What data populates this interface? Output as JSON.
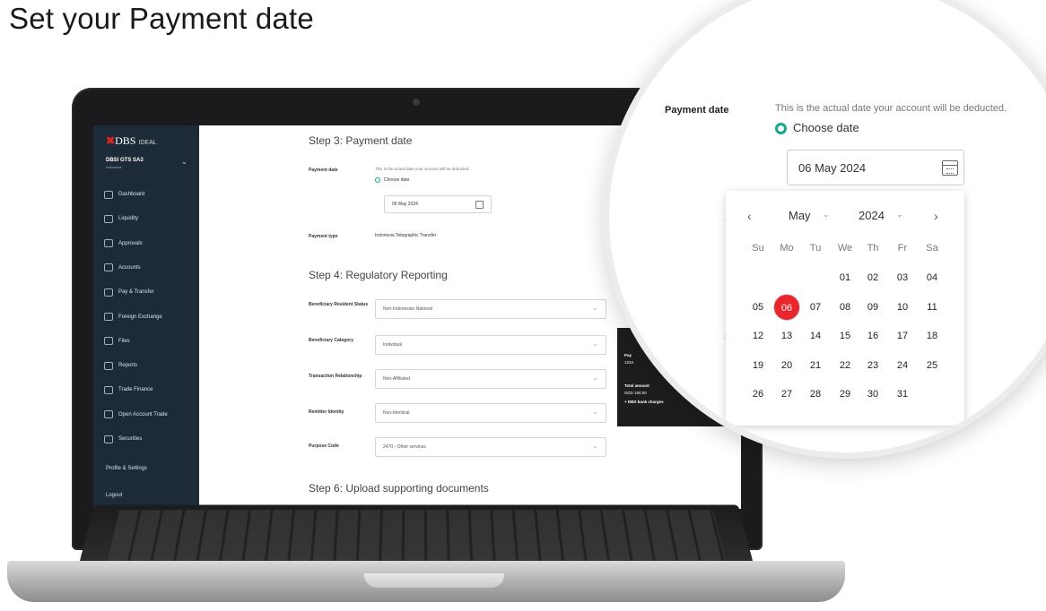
{
  "heading": "Set your Payment date",
  "sidebar": {
    "logo_mark": "DBS",
    "logo_suffix": "IDEAL",
    "account_name": "DBSI GTS SA3",
    "account_sub": "Indonesia",
    "items": [
      {
        "label": "Dashboard",
        "icon": "dashboard-icon"
      },
      {
        "label": "Liquidity",
        "icon": "liquidity-icon"
      },
      {
        "label": "Approvals",
        "icon": "approvals-icon"
      },
      {
        "label": "Accounts",
        "icon": "accounts-icon"
      },
      {
        "label": "Pay & Transfer",
        "icon": "transfer-icon"
      },
      {
        "label": "Foreign Exchange",
        "icon": "exchange-icon"
      },
      {
        "label": "Files",
        "icon": "files-icon"
      },
      {
        "label": "Reports",
        "icon": "reports-icon"
      },
      {
        "label": "Trade Finance",
        "icon": "trade-icon"
      },
      {
        "label": "Open Account Trade",
        "icon": "open-account-icon"
      },
      {
        "label": "Securities",
        "icon": "securities-icon"
      }
    ],
    "profile": "Profile & Settings",
    "logout": "Logout"
  },
  "form": {
    "step3_title": "Step 3: Payment date",
    "payment_date_label": "Payment date",
    "payment_date_hint": "This is the actual date your account will be deducted.",
    "choose_date": "Choose date",
    "date_value": "06 May 2024",
    "payment_type_label": "Payment type",
    "payment_type_value": "Indonesia Telegraphic Transfer",
    "step4_title": "Step 4: Regulatory Reporting",
    "fields": [
      {
        "label": "Beneficiary Resident Status",
        "value": "Non-Indonesian National"
      },
      {
        "label": "Beneficiary Category",
        "value": "Individual"
      },
      {
        "label": "Transaction Relationship",
        "value": "Non-Affiliated"
      },
      {
        "label": "Remitter Identity",
        "value": "Non-Identical"
      },
      {
        "label": "Purpose Code",
        "value": "2470 - Other services"
      }
    ],
    "step6_title": "Step 6: Upload supporting documents"
  },
  "summary": {
    "pay_label": "Pay",
    "pay_value": "1234",
    "total_label": "Total amount",
    "total_value": "SGD 150.00",
    "charges": "+ DBS bank charges"
  },
  "magnifier": {
    "label": "Payment date",
    "hint": "This is the actual date your account will be deducted.",
    "choose_date": "Choose date",
    "date_value": "06 May 2024",
    "month": "May",
    "year": "2024",
    "weekdays": [
      "Su",
      "Mo",
      "Tu",
      "We",
      "Th",
      "Fr",
      "Sa"
    ],
    "selected_day": "06",
    "accent": "#e8262b",
    "radio_color": "#19a78a"
  }
}
